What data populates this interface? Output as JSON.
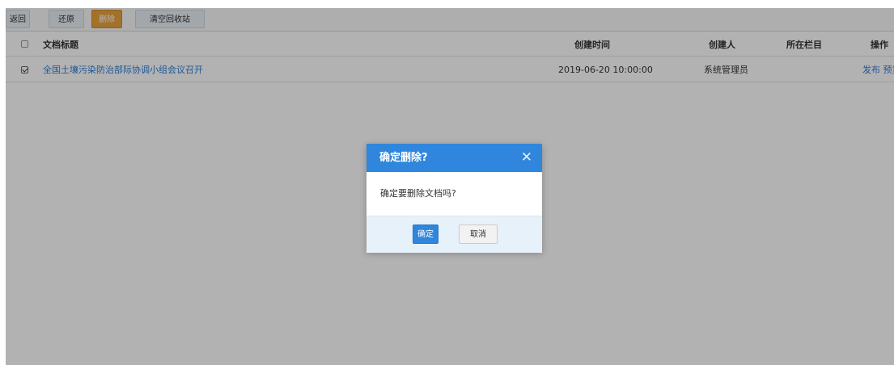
{
  "toolbar": {
    "back_label": "返回",
    "restore_label": "还原",
    "delete_label": "删除",
    "empty_bin_label": "清空回收站"
  },
  "table": {
    "headers": {
      "title": "文档标题",
      "created_time": "创建时间",
      "creator": "创建人",
      "column": "所在栏目",
      "actions": "操作"
    },
    "rows": [
      {
        "checked": true,
        "title": "全国土壤污染防治部际协调小组会议召开",
        "created_time": "2019-06-20 10:00:00",
        "creator": "系统管理员",
        "column": "",
        "actions": "发布 预览"
      }
    ]
  },
  "modal": {
    "title": "确定删除?",
    "close_glyph": "✕",
    "message": "确定要删除文档吗?",
    "ok_label": "确定",
    "cancel_label": "取消"
  },
  "colors": {
    "modal_header": "#2f86dc",
    "delete_button": "#e8a33d",
    "link": "#2b7bd6"
  }
}
